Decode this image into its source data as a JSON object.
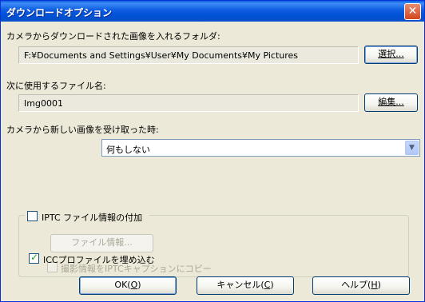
{
  "dialog": {
    "title": "ダウンロードオプション",
    "close_symbol": "✕"
  },
  "folder": {
    "label": "カメラからダウンロードされた画像を入れるフォルダ:",
    "path": "F:¥Documents and Settings¥User¥My Documents¥My Pictures",
    "browse_button": "選択..."
  },
  "filename": {
    "label": "次に使用するファイル名:",
    "value": "Img0001",
    "edit_button": "編集..."
  },
  "on_receive": {
    "label": "カメラから新しい画像を受け取った時:",
    "selected": "何もしない"
  },
  "iptc": {
    "checkbox_label": "IPTC ファイル情報の付加",
    "checked": false,
    "file_info_button": "ファイル情報...",
    "copy_label": "撮影情報をIPTCキャプションにコピー"
  },
  "icc": {
    "checkbox_label": "ICCプロファイルを埋め込む",
    "checked": true
  },
  "buttons": {
    "ok_label": "OK(",
    "ok_key": "O",
    "ok_end": ")",
    "cancel_label": "キャンセル(",
    "cancel_key": "C",
    "cancel_end": ")",
    "help_label": "ヘルプ(",
    "help_key": "H",
    "help_end": ")"
  }
}
